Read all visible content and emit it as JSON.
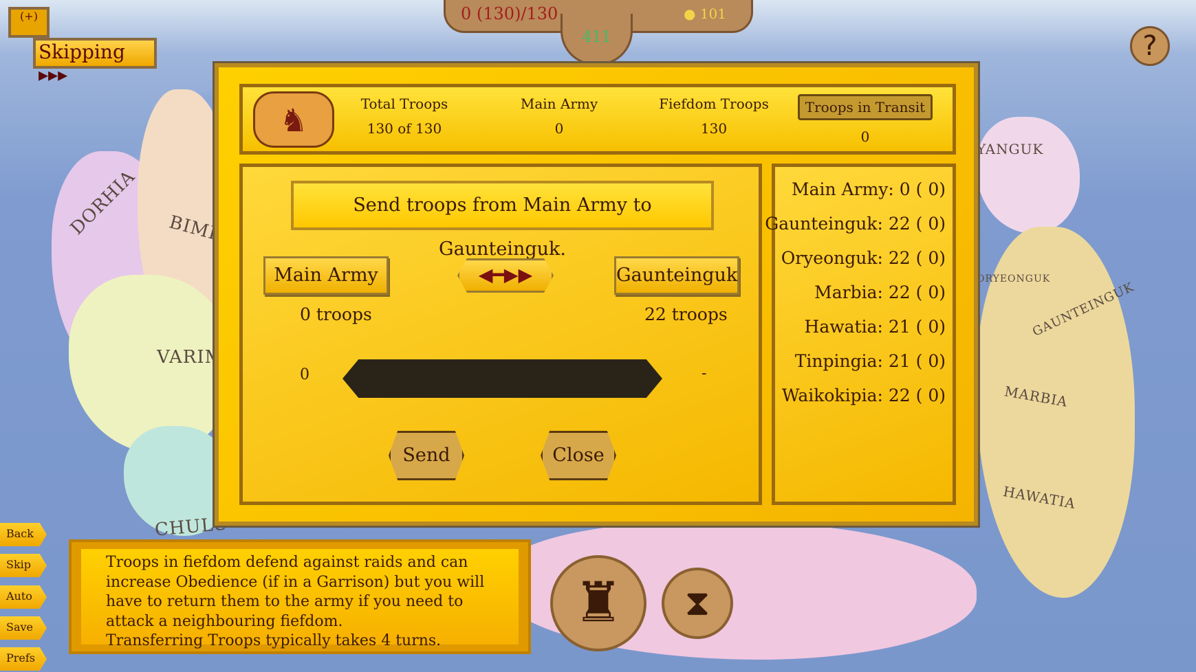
{
  "top": {
    "troops": "0 (130)/130",
    "gold": "101",
    "turn": "411",
    "skipping": "Skipping ▸▸▸",
    "chat": "(+)",
    "help": "?"
  },
  "map_labels": [
    "DORHIA",
    "BIMHI",
    "VARIMI",
    "CHULU",
    "YANGUK",
    "ORYEONGUK",
    "GAUNTEINGUK",
    "MARBIA",
    "HAWATIA"
  ],
  "header": {
    "total_label": "Total Troops",
    "total_value": "130 of 130",
    "main_label": "Main Army",
    "main_value": "0",
    "fief_label": "Fiefdom Troops",
    "fief_value": "130",
    "transit_label": "Troops in Transit",
    "transit_value": "0"
  },
  "transfer": {
    "instruction": "Send troops from Main Army to Gaunteinguk.",
    "from": "Main Army",
    "to": "Gaunteinguk",
    "from_troops": "0 troops",
    "to_troops": "22 troops",
    "slider_min": "0",
    "slider_max": "-",
    "send": "Send",
    "close": "Close"
  },
  "armies": [
    {
      "name": "Main Army:",
      "value": "0 ( 0)"
    },
    {
      "name": "Gaunteinguk:",
      "value": "22 ( 0)"
    },
    {
      "name": "Oryeonguk:",
      "value": "22 ( 0)"
    },
    {
      "name": "Marbia:",
      "value": "22 ( 0)"
    },
    {
      "name": "Hawatia:",
      "value": "21 ( 0)"
    },
    {
      "name": "Tinpingia:",
      "value": "21 ( 0)"
    },
    {
      "name": "Waikokipia:",
      "value": "22 ( 0)"
    }
  ],
  "tooltip": {
    "line1": "Troops in fiefdom defend against raids and can increase Obedience (if in a Garrison) but you will have to return them to the army if you need to attack a neighbouring fiefdom.",
    "line2": "Transferring Troops typically takes 4 turns."
  },
  "side_buttons": [
    "Back",
    "Skip",
    "Auto",
    "Save",
    "Prefs"
  ]
}
